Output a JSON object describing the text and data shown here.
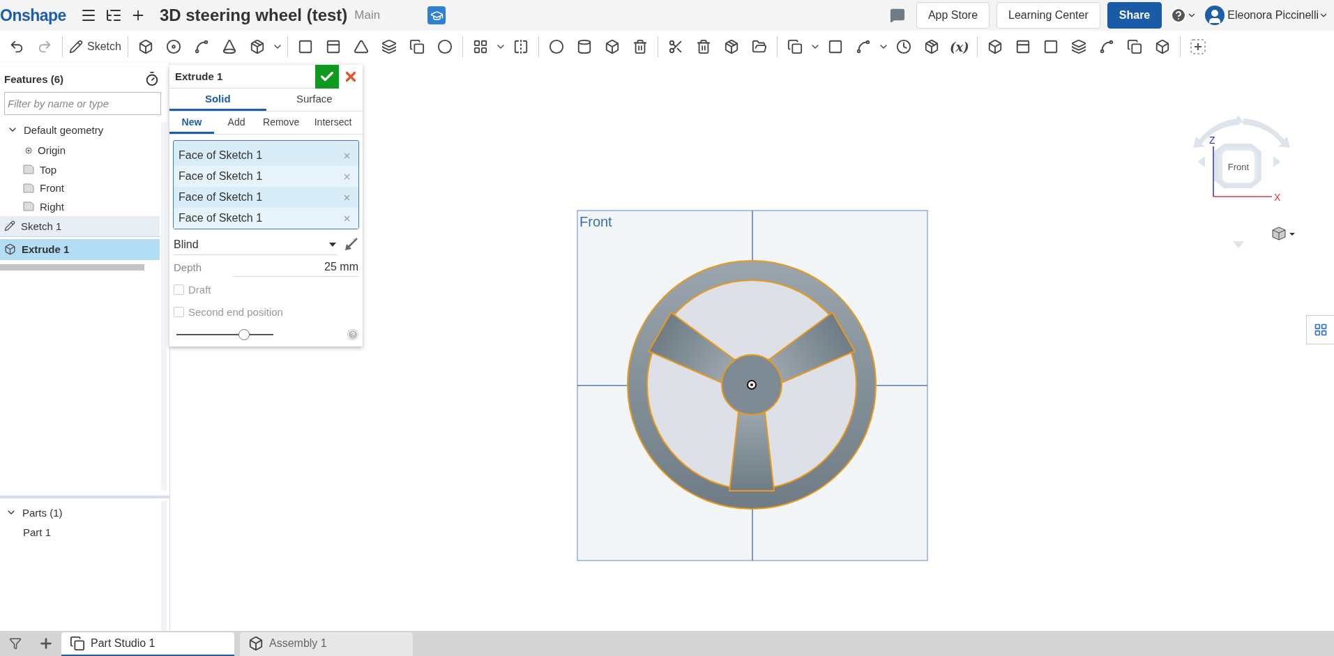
{
  "header": {
    "logo": "Onshape",
    "document_title": "3D steering wheel (test)",
    "branch": "Main",
    "buttons": [
      {
        "label": "App Store",
        "kind": "plain"
      },
      {
        "label": "Learning Center",
        "kind": "plain"
      },
      {
        "label": "Share",
        "kind": "primary"
      }
    ],
    "user": "Eleonora Piccinelli"
  },
  "toolbar": {
    "sketch_label": "Sketch",
    "variable_label": "(x)"
  },
  "feature_list": {
    "title": "Features (6)",
    "filter": {
      "placeholder": "Filter by name or type"
    },
    "items": [
      {
        "label": "Default geometry",
        "kind": "folder",
        "expanded": true,
        "selected": false,
        "children": [
          {
            "label": "Origin",
            "kind": "point"
          },
          {
            "label": "Top",
            "kind": "plane"
          },
          {
            "label": "Front",
            "kind": "plane"
          },
          {
            "label": "Right",
            "kind": "plane"
          }
        ]
      },
      {
        "label": "Sketch 1",
        "kind": "sketch",
        "selected": false,
        "hovered": true
      },
      {
        "label": "Extrude 1",
        "kind": "extrude",
        "selected": true,
        "hovered": false
      }
    ]
  },
  "parts": {
    "title": "Parts (1)",
    "expanded": true,
    "items": [
      "Part 1"
    ]
  },
  "extrude_dialog": {
    "title": "Extrude 1",
    "type_tabs": [
      {
        "label": "Solid",
        "selected": true
      },
      {
        "label": "Surface",
        "selected": false
      }
    ],
    "operation_tabs": [
      {
        "label": "New",
        "selected": true
      },
      {
        "label": "Add",
        "selected": false
      },
      {
        "label": "Remove",
        "selected": false
      },
      {
        "label": "Intersect",
        "selected": false
      }
    ],
    "selections": [
      "Face of Sketch 1",
      "Face of Sketch 1",
      "Face of Sketch 1",
      "Face of Sketch 1"
    ],
    "end_type": "Blind",
    "depth": {
      "label": "Depth",
      "value": "25 mm"
    },
    "options": [
      {
        "label": "Draft",
        "checked": false
      },
      {
        "label": "Second end position",
        "checked": false
      }
    ],
    "slider": {
      "level": 0.7
    }
  },
  "viewport": {
    "plane_label": "Front",
    "view_cube": {
      "face": "Front",
      "axes": [
        "Z",
        "X"
      ]
    }
  },
  "tabs": [
    {
      "label": "Part Studio 1",
      "kind": "part_studio",
      "selected": true
    },
    {
      "label": "Assembly 1",
      "kind": "assembly",
      "selected": false
    }
  ]
}
